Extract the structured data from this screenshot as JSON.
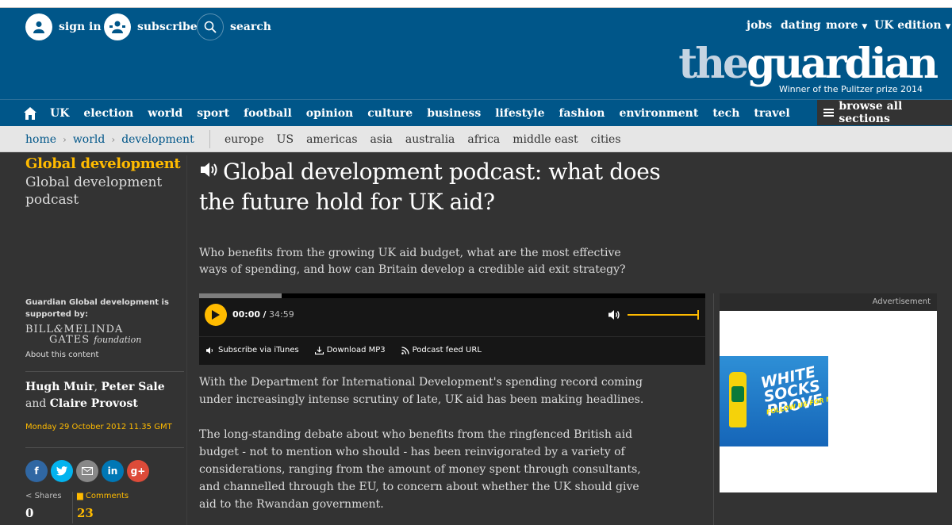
{
  "header": {
    "sign_in": "sign in",
    "subscribe": "subscribe",
    "search": "search",
    "jobs": "jobs",
    "dating": "dating",
    "more": "more",
    "edition": "UK edition",
    "logo_the": "the",
    "logo_guardian": "guardian",
    "tagline": "Winner of the Pulitzer prize 2014"
  },
  "nav": {
    "items": [
      "UK",
      "election",
      "world",
      "sport",
      "football",
      "opinion",
      "culture",
      "business",
      "lifestyle",
      "fashion",
      "environment",
      "tech",
      "travel"
    ],
    "browse": "browse all sections"
  },
  "breadcrumb": {
    "home": "home",
    "world": "world",
    "development": "development"
  },
  "subnav": [
    "europe",
    "US",
    "americas",
    "asia",
    "australia",
    "africa",
    "middle east",
    "cities"
  ],
  "sidebar": {
    "section": "Global development",
    "series": "Global development podcast",
    "supported_by": "Guardian Global development is supported by:",
    "sponsor_line1": "BILL",
    "sponsor_amp": "&",
    "sponsor_line1b": "MELINDA",
    "sponsor_line2": "GATES",
    "sponsor_foundation": "foundation",
    "about": "About this content",
    "authors_a": "Hugh Muir",
    "authors_sep1": ",",
    "authors_b": "Peter Sale",
    "authors_and": "and",
    "authors_c": "Claire Provost",
    "date": "Monday 29 October 2012 11.35 GMT",
    "shares_label": "Shares",
    "shares_count": "0",
    "comments_label": "Comments",
    "comments_count": "23"
  },
  "article": {
    "headline": "Global development podcast: what does the future hold for UK aid?",
    "standfirst": "Who benefits from the growing UK aid budget, what are the most effective ways of spending, and how can Britain develop a credible aid exit strategy?",
    "para1": "With the Department for International Development's spending record coming under increasingly intense scrutiny of late, UK aid has been making headlines.",
    "para2": "The long-standing debate about who benefits from the ringfenced British aid budget - not to mention who should - has been reinvigorated by a variety of considerations, ranging from the amount of money spent through consultants, and channelled through the EU, to concern about whether the UK should give aid to the Rwandan government."
  },
  "player": {
    "current": "00:00",
    "slash": "/",
    "duration": "34:59",
    "progress": 0.163,
    "volume": 1.0,
    "subscribe_itunes": "Subscribe via iTunes",
    "download": "Download MP3",
    "feed": "Podcast feed URL"
  },
  "ad": {
    "label": "Advertisement",
    "line1": "WHITE",
    "line2": "SOCKS",
    "line3": "PROVE IT!",
    "line4": "FOLLOW US FOR MORE"
  },
  "colors": {
    "brand_blue": "#005689",
    "accent_yellow": "#ffbb00",
    "background": "#333333"
  }
}
